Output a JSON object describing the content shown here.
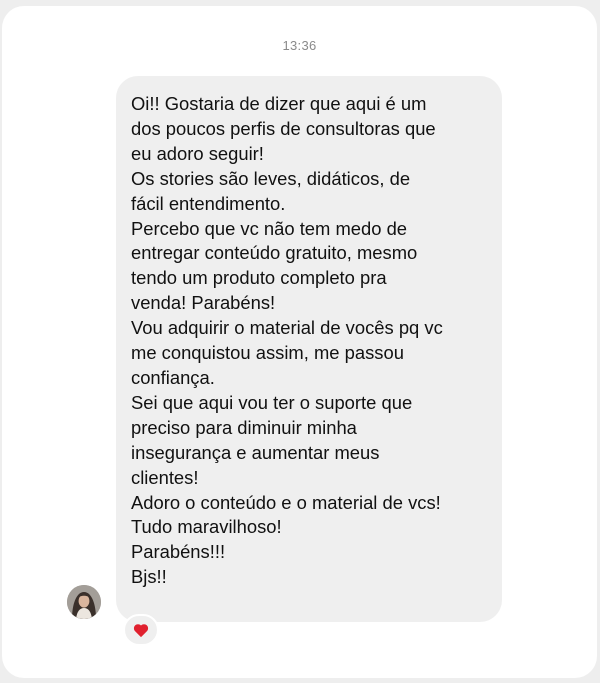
{
  "chat": {
    "timestamp": "13:36",
    "message": {
      "lines": [
        "Oi!! Gostaria de dizer que aqui é um",
        "dos poucos perfis de consultoras que",
        "eu adoro seguir!",
        "Os stories são leves, didáticos, de",
        "fácil entendimento.",
        "Percebo que vc não tem medo de",
        "entregar conteúdo gratuito, mesmo",
        "tendo um produto completo pra",
        "venda! Parabéns!",
        "Vou adquirir o material de vocês pq vc",
        "me conquistou assim, me passou",
        "confiança.",
        "Sei que aqui vou ter o suporte que",
        "preciso para diminuir minha",
        "insegurança e aumentar meus",
        "clientes!",
        "Adoro o conteúdo e o material de vcs!",
        "Tudo maravilhoso!",
        "Parabéns!!!",
        "Bjs!!"
      ]
    },
    "reaction": {
      "icon": "heart-icon",
      "color": "#e0202e"
    }
  },
  "colors": {
    "background": "#eeeeee",
    "card": "#ffffff",
    "bubble": "#efefef",
    "text": "#111111",
    "timestamp": "#8a8a8a"
  }
}
